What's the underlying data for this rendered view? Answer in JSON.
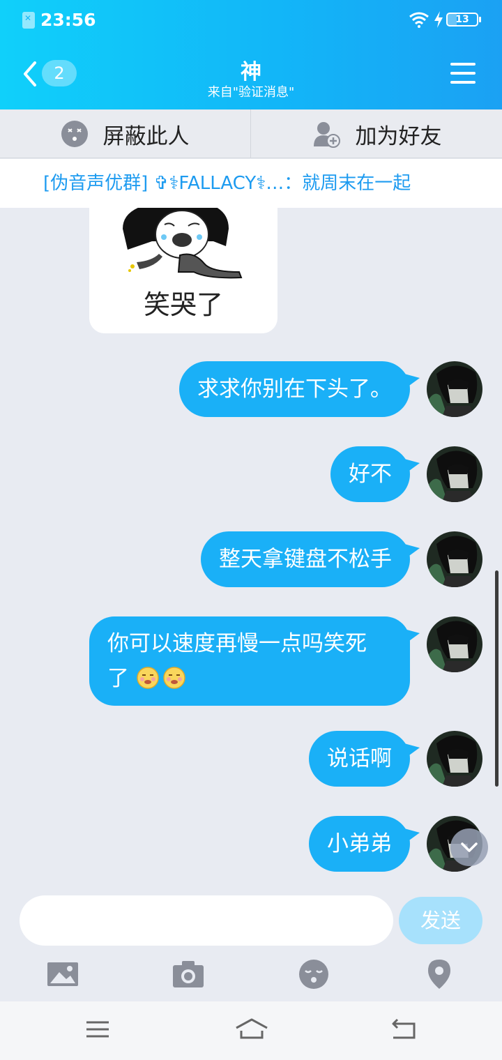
{
  "status_bar": {
    "time": "23:56",
    "battery_level": "13"
  },
  "header": {
    "title": "神",
    "subtitle": "来自\"验证消息\"",
    "unread_count": "2"
  },
  "actions": {
    "block_label": "屏蔽此人",
    "add_friend_label": "加为好友"
  },
  "group_notice": {
    "text": "[伪音声优群] ✞⚕FALLACY⚕…：就周末在一起"
  },
  "sticker": {
    "caption": "笑哭了"
  },
  "messages": [
    {
      "text": "求求你别在下头了。"
    },
    {
      "text": "好不"
    },
    {
      "text": "整天拿键盘不松手"
    },
    {
      "text": "你可以速度再慢一点吗笑死了",
      "line1": "你可以速度再慢一点吗笑死",
      "line2": "了"
    },
    {
      "text": "说话啊"
    },
    {
      "text": "小弟弟"
    }
  ],
  "input": {
    "value": "",
    "send_label": "发送"
  },
  "colors": {
    "header_start": "#10d0fa",
    "header_end": "#1ba1f3",
    "bubble": "#1ab0f7",
    "link": "#1d9bf0"
  },
  "icons": [
    "sim-icon",
    "wifi-icon",
    "charge-icon",
    "battery-icon",
    "back-chevron-icon",
    "menu-icon",
    "block-icon",
    "add-friend-icon",
    "image-icon",
    "camera-icon",
    "emoji-icon",
    "location-icon",
    "scroll-down-icon",
    "nav-menu-icon",
    "nav-home-icon",
    "nav-back-icon"
  ]
}
